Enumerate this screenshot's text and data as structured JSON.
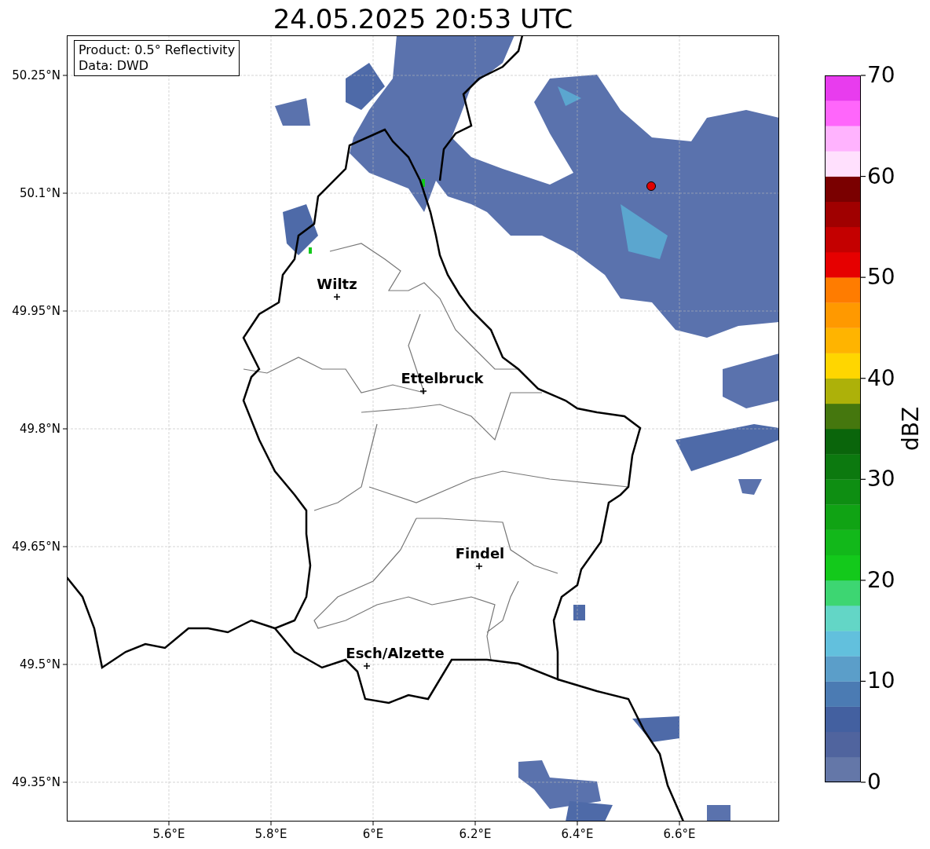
{
  "title": "24.05.2025 20:53 UTC",
  "info_box": [
    "Product: 0.5° Reflectivity",
    "Data: DWD"
  ],
  "map": {
    "yticks": [
      "50.25°N",
      "50.1°N",
      "49.95°N",
      "49.8°N",
      "49.65°N",
      "49.5°N",
      "49.35°N"
    ],
    "xticks": [
      "5.6°E",
      "5.8°E",
      "6°E",
      "6.2°E",
      "6.4°E",
      "6.6°E"
    ],
    "places": [
      {
        "name": "Wiltz"
      },
      {
        "name": "Ettelbruck"
      },
      {
        "name": "Findel"
      },
      {
        "name": "Esch/Alzette"
      }
    ]
  },
  "colorbar": {
    "label": "dBZ",
    "ticks": [
      "70",
      "60",
      "50",
      "40",
      "30",
      "20",
      "10",
      "0"
    ],
    "bins": [
      {
        "color": "#6477a8"
      },
      {
        "color": "#50649e"
      },
      {
        "color": "#4360a0"
      },
      {
        "color": "#4b7bb3"
      },
      {
        "color": "#5b9ec9"
      },
      {
        "color": "#62c0dd"
      },
      {
        "color": "#63d6c6"
      },
      {
        "color": "#3dd672"
      },
      {
        "color": "#13c91b"
      },
      {
        "color": "#12b81a"
      },
      {
        "color": "#10a314"
      },
      {
        "color": "#0e8e12"
      },
      {
        "color": "#0c790f"
      },
      {
        "color": "#0a650b"
      },
      {
        "color": "#45770e"
      },
      {
        "color": "#adb109"
      },
      {
        "color": "#ffd600"
      },
      {
        "color": "#ffb400"
      },
      {
        "color": "#ff9900"
      },
      {
        "color": "#ff7c00"
      },
      {
        "color": "#e60000"
      },
      {
        "color": "#c40000"
      },
      {
        "color": "#a00000"
      },
      {
        "color": "#7a0000"
      },
      {
        "color": "#ffe0fd"
      },
      {
        "color": "#ffb3fe"
      },
      {
        "color": "#ff66fb"
      },
      {
        "color": "#e83cee"
      }
    ]
  }
}
